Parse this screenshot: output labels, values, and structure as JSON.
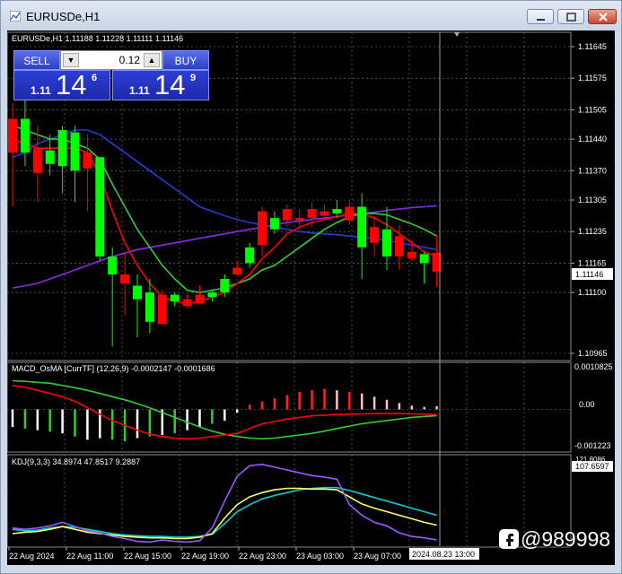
{
  "window": {
    "title": "EURUSDe,H1"
  },
  "main_panel": {
    "header": "EURUSDe,H1  1.11188 1.11228 1.11111 1.11146"
  },
  "trade_panel": {
    "sell_label": "SELL",
    "buy_label": "BUY",
    "lot_value": "0.12",
    "bid": {
      "prefix": "1.11",
      "big": "14",
      "sup": "6"
    },
    "ask": {
      "prefix": "1.11",
      "big": "14",
      "sup": "9"
    }
  },
  "price_axis": {
    "labels": [
      "1.11645",
      "1.11575",
      "1.11505",
      "1.11440",
      "1.11370",
      "1.11305",
      "1.11235",
      "1.11165",
      "1.11100",
      "1.10965"
    ],
    "current_price_tag": "1.11146"
  },
  "macd_panel": {
    "header": "MACD_OsMA [CurrTF] (12,26,9) -0.0002147 -0.0001686",
    "axis_labels": [
      "0.0010825",
      "0.00",
      "-0.001223"
    ]
  },
  "kdj_panel": {
    "header": "KDJ(9,3,3) 34.8974 47.8517 9.2887",
    "axis_labels": [
      "121.8086",
      "107.6597"
    ]
  },
  "time_axis": {
    "labels": [
      "22 Aug 2024",
      "22 Aug 11:00",
      "22 Aug 15:00",
      "22 Aug 19:00",
      "22 Aug 23:00",
      "23 Aug 03:00",
      "23 Aug 07:00"
    ],
    "cursor_label": "2024.08.23 13:00"
  },
  "watermark": {
    "text": "@989998"
  },
  "colors": {
    "background": "#000000",
    "bull": "#00ff00",
    "bear": "#ff0000",
    "ma_red": "#ff0000",
    "ma_green": "#32cd32",
    "ma_blue": "#1f3fd6",
    "ma_purple": "#8a2be2",
    "grid": "#808080",
    "kdj_k": "#00ced1",
    "kdj_d": "#ffff66",
    "kdj_j": "#9b59ff"
  },
  "chart_data": {
    "type": "candlestick",
    "symbol": "EURUSDe",
    "timeframe": "H1",
    "ylim": [
      1.10965,
      1.11645
    ],
    "candles": [
      {
        "o": 1.11485,
        "h": 1.1152,
        "l": 1.1129,
        "c": 1.1141
      },
      {
        "o": 1.1141,
        "h": 1.1154,
        "l": 1.1138,
        "c": 1.11485
      },
      {
        "o": 1.1142,
        "h": 1.1147,
        "l": 1.113,
        "c": 1.11365
      },
      {
        "o": 1.11385,
        "h": 1.1145,
        "l": 1.1136,
        "c": 1.11415
      },
      {
        "o": 1.1138,
        "h": 1.1147,
        "l": 1.1132,
        "c": 1.1146
      },
      {
        "o": 1.1137,
        "h": 1.1147,
        "l": 1.113,
        "c": 1.11455
      },
      {
        "o": 1.1141,
        "h": 1.1145,
        "l": 1.1128,
        "c": 1.11375
      },
      {
        "o": 1.1118,
        "h": 1.114,
        "l": 1.1117,
        "c": 1.114
      },
      {
        "o": 1.1114,
        "h": 1.112,
        "l": 1.1098,
        "c": 1.1118
      },
      {
        "o": 1.1114,
        "h": 1.1119,
        "l": 1.1105,
        "c": 1.1112
      },
      {
        "o": 1.11085,
        "h": 1.1114,
        "l": 1.11,
        "c": 1.11115
      },
      {
        "o": 1.11035,
        "h": 1.1113,
        "l": 1.1101,
        "c": 1.111
      },
      {
        "o": 1.11095,
        "h": 1.11105,
        "l": 1.1103,
        "c": 1.1103
      },
      {
        "o": 1.1108,
        "h": 1.111,
        "l": 1.1107,
        "c": 1.11095
      },
      {
        "o": 1.11085,
        "h": 1.11095,
        "l": 1.11065,
        "c": 1.1107
      },
      {
        "o": 1.11095,
        "h": 1.11115,
        "l": 1.11075,
        "c": 1.11075
      },
      {
        "o": 1.1109,
        "h": 1.11105,
        "l": 1.1108,
        "c": 1.111
      },
      {
        "o": 1.111,
        "h": 1.1114,
        "l": 1.1109,
        "c": 1.1113
      },
      {
        "o": 1.11155,
        "h": 1.1117,
        "l": 1.11135,
        "c": 1.1114
      },
      {
        "o": 1.11165,
        "h": 1.1121,
        "l": 1.11155,
        "c": 1.112
      },
      {
        "o": 1.1128,
        "h": 1.1129,
        "l": 1.1118,
        "c": 1.11205
      },
      {
        "o": 1.1124,
        "h": 1.1128,
        "l": 1.1123,
        "c": 1.11265
      },
      {
        "o": 1.11285,
        "h": 1.11295,
        "l": 1.11245,
        "c": 1.1126
      },
      {
        "o": 1.11265,
        "h": 1.11285,
        "l": 1.11245,
        "c": 1.1126
      },
      {
        "o": 1.11285,
        "h": 1.113,
        "l": 1.11245,
        "c": 1.11265
      },
      {
        "o": 1.1128,
        "h": 1.11295,
        "l": 1.1126,
        "c": 1.1127
      },
      {
        "o": 1.11275,
        "h": 1.11305,
        "l": 1.11265,
        "c": 1.11285
      },
      {
        "o": 1.1129,
        "h": 1.11305,
        "l": 1.1125,
        "c": 1.1126
      },
      {
        "o": 1.112,
        "h": 1.1132,
        "l": 1.1113,
        "c": 1.1129
      },
      {
        "o": 1.11245,
        "h": 1.1127,
        "l": 1.1118,
        "c": 1.1121
      },
      {
        "o": 1.1118,
        "h": 1.1129,
        "l": 1.1115,
        "c": 1.1124
      },
      {
        "o": 1.11225,
        "h": 1.1125,
        "l": 1.1115,
        "c": 1.1118
      },
      {
        "o": 1.1119,
        "h": 1.11215,
        "l": 1.1117,
        "c": 1.11175
      },
      {
        "o": 1.11165,
        "h": 1.1119,
        "l": 1.1112,
        "c": 1.11185
      },
      {
        "o": 1.11188,
        "h": 1.11228,
        "l": 1.11111,
        "c": 1.11146
      }
    ],
    "ma_red": [
      1.1144,
      1.1143,
      1.1142,
      1.1142,
      1.1142,
      1.1142,
      1.1141,
      1.1136,
      1.1128,
      1.1121,
      1.1116,
      1.1112,
      1.1109,
      1.1108,
      1.11075,
      1.1108,
      1.1109,
      1.111,
      1.1112,
      1.1114,
      1.11175,
      1.112,
      1.1123,
      1.11245,
      1.11255,
      1.11262,
      1.11268,
      1.11275,
      1.11275,
      1.11265,
      1.1125,
      1.1123,
      1.1121,
      1.1119,
      1.1118
    ],
    "ma_green": [
      1.1147,
      1.1146,
      1.1145,
      1.1144,
      1.1144,
      1.1143,
      1.1142,
      1.11395,
      1.1134,
      1.1129,
      1.1124,
      1.112,
      1.1116,
      1.1113,
      1.11105,
      1.111,
      1.11105,
      1.1111,
      1.1112,
      1.1113,
      1.1115,
      1.1116,
      1.1118,
      1.112,
      1.1122,
      1.1124,
      1.11255,
      1.11268,
      1.11275,
      1.11275,
      1.11272,
      1.11262,
      1.11252,
      1.1124,
      1.11225
    ],
    "ma_blue": [
      1.114,
      1.1141,
      1.1143,
      1.1144,
      1.1145,
      1.1146,
      1.1146,
      1.1145,
      1.1143,
      1.1141,
      1.1139,
      1.1137,
      1.1135,
      1.1133,
      1.1131,
      1.1129,
      1.1128,
      1.1127,
      1.11262,
      1.11255,
      1.1125,
      1.11245,
      1.1124,
      1.11235,
      1.11232,
      1.1123,
      1.11228,
      1.11225,
      1.11222,
      1.1122,
      1.11215,
      1.1121,
      1.11205,
      1.112,
      1.11195
    ],
    "ma_purple": [
      1.1111,
      1.11115,
      1.1112,
      1.1113,
      1.1114,
      1.1115,
      1.1116,
      1.1117,
      1.1118,
      1.11187,
      1.11195,
      1.112,
      1.11205,
      1.1121,
      1.11215,
      1.1122,
      1.11225,
      1.1123,
      1.11235,
      1.1124,
      1.11245,
      1.1125,
      1.11255,
      1.11258,
      1.11262,
      1.11265,
      1.11268,
      1.11272,
      1.11275,
      1.11278,
      1.11282,
      1.11285,
      1.11288,
      1.1129,
      1.11292
    ],
    "macd": {
      "ylim": [
        -0.001223,
        0.0010825
      ],
      "hist": [
        -0.00055,
        -0.0006,
        -0.00065,
        -0.0007,
        -0.00075,
        -0.00085,
        -0.00095,
        -0.0009,
        -0.00095,
        -0.001,
        -0.0009,
        -0.00085,
        -0.0008,
        -0.00075,
        -0.00065,
        -0.00055,
        -0.00045,
        -0.00035,
        -0.0001,
        0.00015,
        0.00025,
        0.00035,
        0.00045,
        0.00055,
        0.0006,
        0.00065,
        0.0006,
        0.00055,
        0.0005,
        0.0004,
        0.0003,
        0.0002,
        0.00012,
        8e-05,
        0.0001
      ],
      "hist_colors": [
        "#ffffff",
        "#32cd32",
        "#ffffff",
        "#32cd32",
        "#ffffff",
        "#32cd32",
        "#ffffff",
        "#ffffff",
        "#32cd32",
        "#32cd32",
        "#ffffff",
        "#32cd32",
        "#ffffff",
        "#32cd32",
        "#ffffff",
        "#ffffff",
        "#32cd32",
        "#ffffff",
        "#ffffff",
        "#ff2020",
        "#ff2020",
        "#ff2020",
        "#ff2020",
        "#ff2020",
        "#ff2020",
        "#ff2020",
        "#ffc0cb",
        "#ff2020",
        "#ffc0cb",
        "#ffc0cb",
        "#ffc0cb",
        "#ffc0cb",
        "#ffc0cb",
        "#ffc0cb",
        "#ffc0cb"
      ],
      "signal_red": [
        0.00075,
        0.0007,
        0.0006,
        0.0005,
        0.0004,
        0.00025,
        5e-05,
        -0.00015,
        -0.00035,
        -0.0005,
        -0.00065,
        -0.00078,
        -0.00085,
        -0.0009,
        -0.00092,
        -0.0009,
        -0.00085,
        -0.0008,
        -0.00075,
        -0.0006,
        -0.00045,
        -0.00038,
        -0.0003,
        -0.00025,
        -0.0002,
        -0.00018,
        -0.00016,
        -0.00015,
        -0.00014,
        -0.00013,
        -0.00013,
        -0.00013,
        -0.00014,
        -0.00015,
        -0.00016
      ],
      "signal_green": [
        0.0009,
        0.00088,
        0.00085,
        0.00082,
        0.00075,
        0.00068,
        0.0006,
        0.0005,
        0.0004,
        0.0003,
        0.00018,
        5e-05,
        -0.0001,
        -0.00025,
        -0.0004,
        -0.00055,
        -0.00068,
        -0.00078,
        -0.00085,
        -0.0009,
        -0.00092,
        -0.0009,
        -0.00085,
        -0.0008,
        -0.00075,
        -0.00068,
        -0.0006,
        -0.00052,
        -0.00045,
        -0.0004,
        -0.00035,
        -0.0003,
        -0.00025,
        -0.00022,
        -0.0002
      ]
    },
    "kdj": {
      "ylim": [
        0,
        121.8086
      ],
      "k": [
        20,
        18,
        19,
        22,
        24,
        23,
        20,
        17,
        14,
        12,
        11,
        10,
        10,
        9,
        9,
        10,
        13,
        28,
        45,
        55,
        63,
        68,
        72,
        76,
        78,
        79,
        79,
        75,
        70,
        65,
        60,
        55,
        50,
        45,
        40
      ],
      "d": [
        14,
        16,
        17,
        20,
        24,
        20,
        16,
        14,
        12,
        10,
        9,
        8,
        8,
        7,
        7,
        9,
        14,
        36,
        55,
        66,
        72,
        76,
        78,
        78,
        77,
        77,
        76,
        66,
        56,
        50,
        45,
        40,
        35,
        30,
        26
      ],
      "j": [
        22,
        20,
        22,
        25,
        30,
        24,
        18,
        15,
        10,
        7,
        3,
        2,
        5,
        3,
        2,
        4,
        22,
        60,
        95,
        110,
        112,
        108,
        104,
        100,
        96,
        94,
        91,
        55,
        40,
        30,
        25,
        15,
        10,
        8,
        5
      ]
    }
  }
}
